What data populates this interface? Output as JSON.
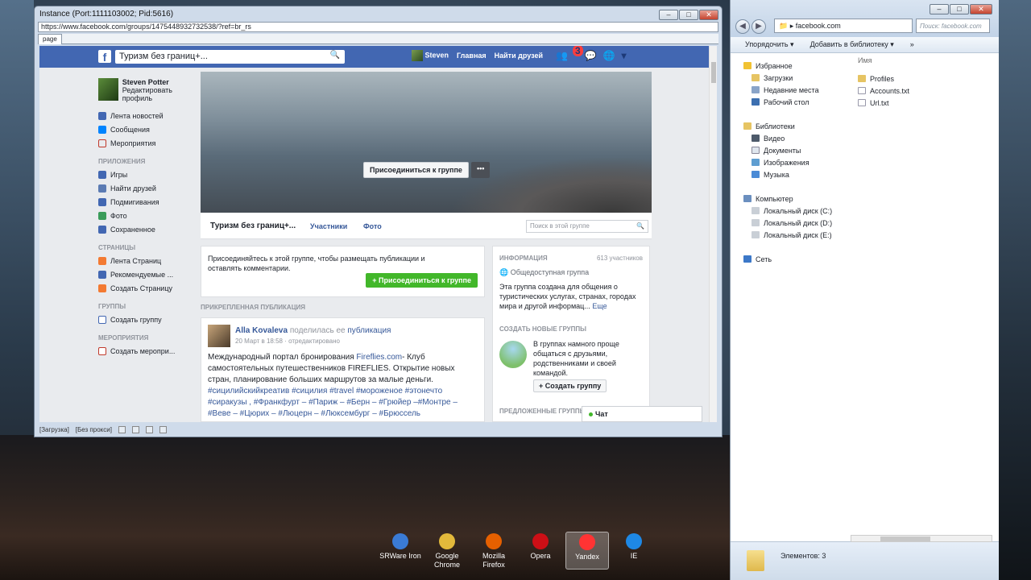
{
  "browser": {
    "title": "Instance (Port:1111103002; Pid:5616)",
    "url": "https://www.facebook.com/groups/1475448932732538/?ref=br_rs",
    "tab": "page",
    "status": [
      "[Загрузка]",
      "[Без прокси]"
    ]
  },
  "fb": {
    "search": "Туризм без границ+...",
    "user_short": "Steven",
    "nav_home": "Главная",
    "nav_friends": "Найти друзей",
    "notif_count": "3",
    "profile_name": "Steven Potter",
    "profile_edit": "Редактировать профиль",
    "menu_main": [
      "Лента новостей",
      "Сообщения",
      "Мероприятия"
    ],
    "apps_header": "ПРИЛОЖЕНИЯ",
    "apps": [
      "Игры",
      "Найти друзей",
      "Подмигивания",
      "Фото",
      "Сохраненное"
    ],
    "pages_header": "СТРАНИЦЫ",
    "pages": [
      "Лента Страниц",
      "Рекомендуемые ...",
      "Создать Страницу"
    ],
    "groups_header": "ГРУППЫ",
    "groups": [
      "Создать группу"
    ],
    "events_header": "МЕРОПРИЯТИЯ",
    "events": [
      "Создать меропри..."
    ],
    "join_group": "Присоединиться к группе",
    "more": "•••",
    "group_name": "Туризм без границ+...",
    "tab_members": "Участники",
    "tab_photo": "Фото",
    "group_search": "Поиск в этой группе",
    "join_text": "Присоединяйтесь к этой группе, чтобы размещать публикации и оставлять комментарии.",
    "join_btn": "+ Присоединиться к группе",
    "pinned": "ПРИКРЕПЛЕННАЯ ПУБЛИКАЦИЯ",
    "post_author": "Alla Kovaleva",
    "post_shared": "поделилась ее",
    "post_pub": "публикация",
    "post_meta": "20 Март в 18:58 · отредактировано",
    "post_text": "Международный портал бронирования",
    "post_link": "Fireflies.com",
    "post_text2": "- Клуб самостоятельных путешественников FIREFLIES. Открытие новых стран, планирование больших маршрутов за малые деньги.",
    "post_tags": "#сицилийскийкреатив #сицилия #travel #мороженое #этонечто #сиракузы , #Франкфурт – #Париж – #Берн – #Грюйер –#Монтре – #Веве – #Цюрих – #Люцерн – #Люксембург – #Брюссель",
    "info_header": "ИНФОРМАЦИЯ",
    "members": "613 участников",
    "public_group": "Общедоступная группа",
    "about": "Эта группа создана для общения о туристических услугах, странах, городах мира и другой информац...",
    "more_link": "Еще",
    "create_header": "СОЗДАТЬ НОВЫЕ ГРУППЫ",
    "create_text": "В группах намного проще общаться с друзьями, родственниками и своей командой.",
    "create_btn": "+ Создать группу",
    "suggested": "ПРЕДЛОЖЕННЫЕ ГРУППЫ",
    "chat": "Чат"
  },
  "explorer": {
    "address": "facebook.com",
    "search_placeholder": "Поиск: facebook.com",
    "toolbar": [
      "Упорядочить ▾",
      "Добавить в библиотеку ▾",
      "»"
    ],
    "favorites": "Избранное",
    "fav_items": [
      "Загрузки",
      "Недавние места",
      "Рабочий стол"
    ],
    "libraries": "Библиотеки",
    "lib_items": [
      "Видео",
      "Документы",
      "Изображения",
      "Музыка"
    ],
    "computer": "Компьютер",
    "disks": [
      "Локальный диск (C:)",
      "Локальный диск (D:)",
      "Локальный диск (E:)"
    ],
    "network": "Сеть",
    "col_name": "Имя",
    "files": [
      "Profiles",
      "Accounts.txt",
      "Url.txt"
    ],
    "count": "Элементов: 3"
  },
  "dock": [
    {
      "label": "SRWare Iron",
      "color": "#3a7bd5"
    },
    {
      "label": "Google Chrome",
      "color": "#e2b93b"
    },
    {
      "label": "Mozilla Firefox",
      "color": "#e66000"
    },
    {
      "label": "Opera",
      "color": "#cc0f16"
    },
    {
      "label": "Yandex",
      "color": "#ff3333"
    },
    {
      "label": "IE",
      "color": "#1e88e5"
    }
  ]
}
